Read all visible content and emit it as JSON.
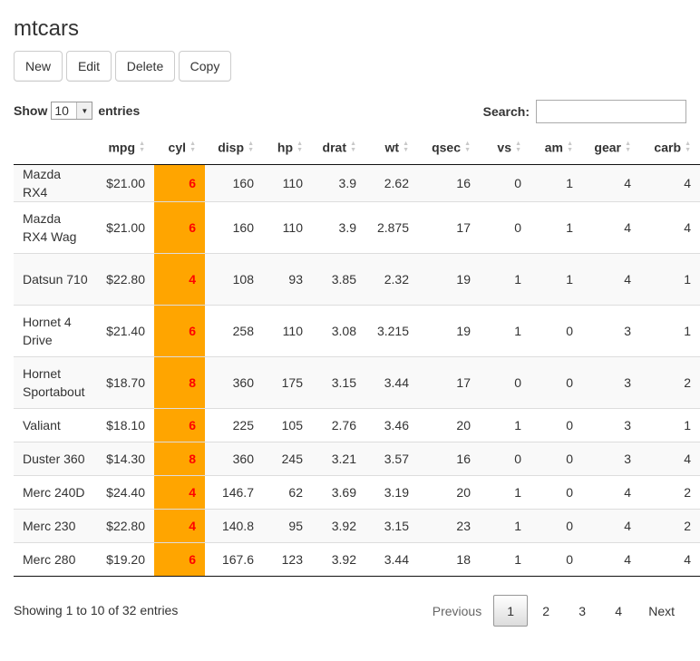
{
  "title": "mtcars",
  "toolbar": {
    "new": "New",
    "edit": "Edit",
    "delete": "Delete",
    "copy": "Copy"
  },
  "length": {
    "show": "Show",
    "value": "10",
    "entries": "entries"
  },
  "search": {
    "label": "Search:",
    "value": ""
  },
  "columns": [
    "",
    "mpg",
    "cyl",
    "disp",
    "hp",
    "drat",
    "wt",
    "qsec",
    "vs",
    "am",
    "gear",
    "carb"
  ],
  "rows": [
    [
      "Mazda RX4",
      "$21.00",
      "6",
      "160",
      "110",
      "3.9",
      "2.62",
      "16",
      "0",
      "1",
      "4",
      "4"
    ],
    [
      "Mazda RX4 Wag",
      "$21.00",
      "6",
      "160",
      "110",
      "3.9",
      "2.875",
      "17",
      "0",
      "1",
      "4",
      "4"
    ],
    [
      "Datsun 710",
      "$22.80",
      "4",
      "108",
      "93",
      "3.85",
      "2.32",
      "19",
      "1",
      "1",
      "4",
      "1"
    ],
    [
      "Hornet 4 Drive",
      "$21.40",
      "6",
      "258",
      "110",
      "3.08",
      "3.215",
      "19",
      "1",
      "0",
      "3",
      "1"
    ],
    [
      "Hornet Sportabout",
      "$18.70",
      "8",
      "360",
      "175",
      "3.15",
      "3.44",
      "17",
      "0",
      "0",
      "3",
      "2"
    ],
    [
      "Valiant",
      "$18.10",
      "6",
      "225",
      "105",
      "2.76",
      "3.46",
      "20",
      "1",
      "0",
      "3",
      "1"
    ],
    [
      "Duster 360",
      "$14.30",
      "8",
      "360",
      "245",
      "3.21",
      "3.57",
      "16",
      "0",
      "0",
      "3",
      "4"
    ],
    [
      "Merc 240D",
      "$24.40",
      "4",
      "146.7",
      "62",
      "3.69",
      "3.19",
      "20",
      "1",
      "0",
      "4",
      "2"
    ],
    [
      "Merc 230",
      "$22.80",
      "4",
      "140.8",
      "95",
      "3.92",
      "3.15",
      "23",
      "1",
      "0",
      "4",
      "2"
    ],
    [
      "Merc 280",
      "$19.20",
      "6",
      "167.6",
      "123",
      "3.92",
      "3.44",
      "18",
      "1",
      "0",
      "4",
      "4"
    ]
  ],
  "info": "Showing 1 to 10 of 32 entries",
  "pagination": {
    "previous": "Previous",
    "pages": [
      "1",
      "2",
      "3",
      "4"
    ],
    "current": "1",
    "next": "Next"
  },
  "colors": {
    "highlight_bg": "#FFA500",
    "highlight_text": "#FF0000",
    "stripe": "#F9F9F9"
  },
  "icons": {
    "sort": "sort-both-icon",
    "select": "chevron-down-icon"
  }
}
